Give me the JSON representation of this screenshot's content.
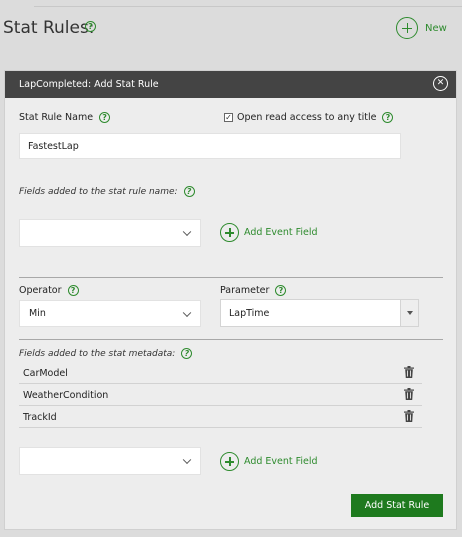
{
  "page": {
    "title": "Stat Rules:",
    "new_label": "New"
  },
  "dialog": {
    "title": "LapCompleted: Add Stat Rule",
    "close_glyph": "✕",
    "stat_rule_name": {
      "label": "Stat Rule Name",
      "value": "FastestLap"
    },
    "open_access": {
      "label": "Open read access to any title",
      "checked_glyph": "✓"
    },
    "name_fields": {
      "label": "Fields added to the stat rule name:",
      "select_value": "",
      "add_label": "Add Event Field"
    },
    "operator": {
      "label": "Operator",
      "value": "Min"
    },
    "parameter": {
      "label": "Parameter",
      "value": "LapTime"
    },
    "metadata": {
      "label": "Fields added to the stat metadata:",
      "items": [
        {
          "name": "CarModel"
        },
        {
          "name": "WeatherCondition"
        },
        {
          "name": "TrackId"
        }
      ],
      "select_value": "",
      "add_label": "Add Event Field"
    },
    "submit_label": "Add Stat Rule"
  },
  "help_glyph": "?",
  "colors": {
    "accent": "#2e8b2e",
    "header_bar": "#444444",
    "submit": "#1e7a1e"
  }
}
